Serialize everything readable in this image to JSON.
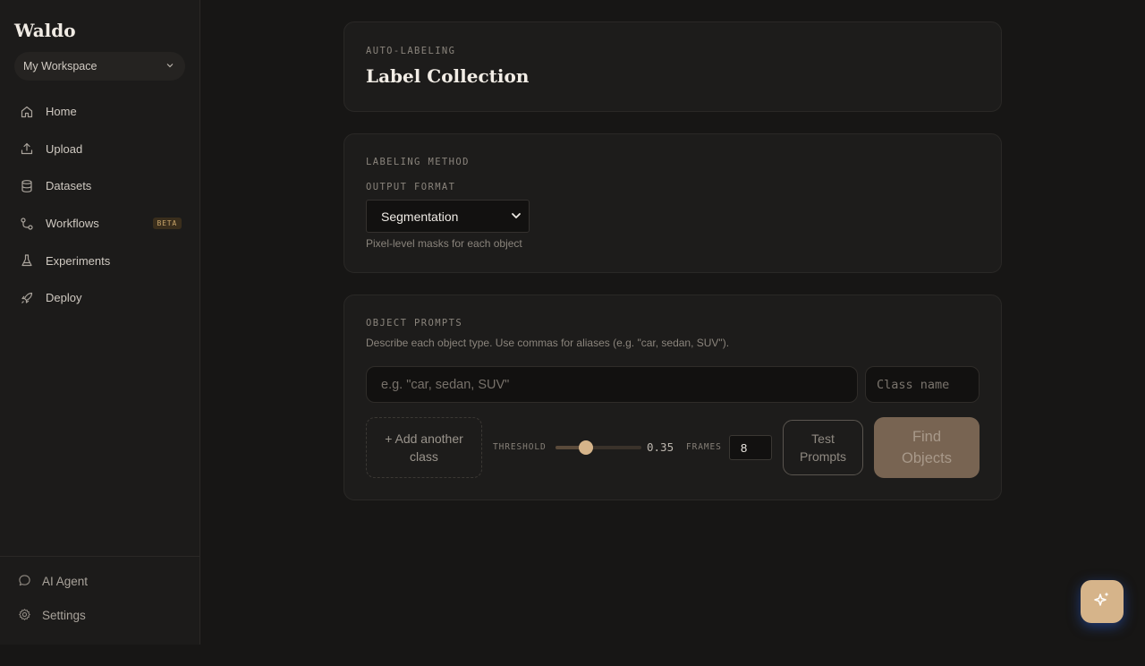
{
  "brand": "Waldo",
  "workspace": {
    "label": "My Workspace"
  },
  "nav": [
    {
      "label": "Home",
      "icon": "home-icon"
    },
    {
      "label": "Upload",
      "icon": "upload-icon"
    },
    {
      "label": "Datasets",
      "icon": "database-icon"
    },
    {
      "label": "Workflows",
      "icon": "workflow-icon",
      "badge": "BETA"
    },
    {
      "label": "Experiments",
      "icon": "flask-icon"
    },
    {
      "label": "Deploy",
      "icon": "rocket-icon"
    }
  ],
  "bottom_nav": [
    {
      "label": "AI Agent",
      "icon": "chat-bubble-icon"
    },
    {
      "label": "Settings",
      "icon": "gear-icon"
    }
  ],
  "header": {
    "eyebrow": "AUTO-LABELING",
    "title": "Label Collection"
  },
  "labeling": {
    "section_label": "LABELING METHOD",
    "output_label": "OUTPUT FORMAT",
    "output_value": "Segmentation",
    "hint": "Pixel-level masks for each object"
  },
  "prompts": {
    "section_label": "OBJECT PROMPTS",
    "description": "Describe each object type. Use commas for aliases (e.g. \"car, sedan, SUV\").",
    "prompt_placeholder": "e.g. \"car, sedan, SUV\"",
    "class_placeholder": "Class name",
    "add_class_line1": "+ Add another",
    "add_class_line2": "class",
    "threshold_label": "THRESHOLD",
    "threshold_value": "0.35",
    "frames_label": "FRAMES",
    "frames_value": "8",
    "test_line1": "Test",
    "test_line2": "Prompts",
    "find_line1": "Find",
    "find_line2": "Objects"
  },
  "colors": {
    "accent": "#d6b48a",
    "background": "#171615",
    "sidebar": "#1c1b1a",
    "card": "#1d1c1b"
  }
}
